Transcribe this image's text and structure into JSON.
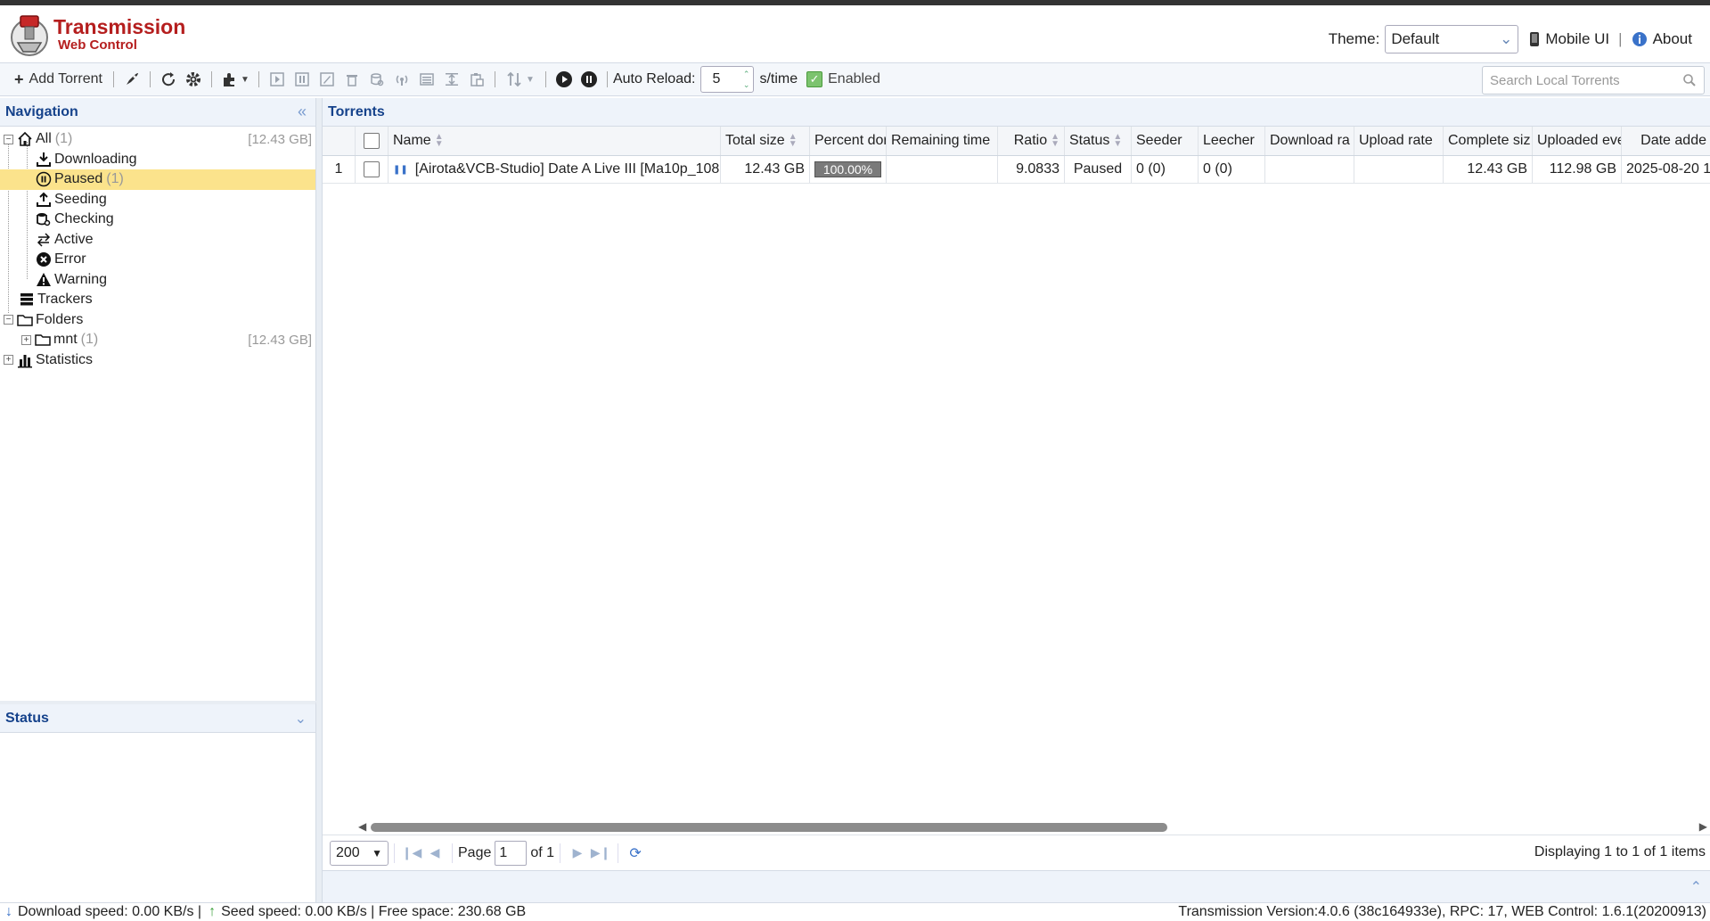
{
  "header": {
    "brand_title": "Transmission",
    "brand_subtitle": "Web Control",
    "theme_label": "Theme:",
    "theme_value": "Default",
    "mobile_ui": "Mobile UI",
    "about": "About"
  },
  "toolbar": {
    "add_torrent": "Add Torrent",
    "auto_reload_label": "Auto Reload:",
    "auto_reload_value": "5",
    "auto_reload_unit": "s/time",
    "enabled_label": "Enabled",
    "search_placeholder": "Search Local Torrents"
  },
  "navigation": {
    "title": "Navigation",
    "all_label": "All",
    "all_count": "(1)",
    "all_size": "[12.43 GB]",
    "downloading": "Downloading",
    "paused": "Paused",
    "paused_count": "(1)",
    "seeding": "Seeding",
    "checking": "Checking",
    "active": "Active",
    "error": "Error",
    "warning": "Warning",
    "trackers": "Trackers",
    "folders": "Folders",
    "mnt_label": "mnt",
    "mnt_count": "(1)",
    "mnt_size": "[12.43 GB]",
    "statistics": "Statistics"
  },
  "status_panel": {
    "title": "Status"
  },
  "torrents": {
    "title": "Torrents",
    "columns": [
      "Name",
      "Total size",
      "Percent dor",
      "Remaining time",
      "Ratio",
      "Status",
      "Seeder",
      "Leecher",
      "Download ra",
      "Upload rate",
      "Complete siz",
      "Uploaded eve",
      "Date adde"
    ],
    "row": {
      "index": "1",
      "name": "[Airota&VCB-Studio] Date A Live III [Ma10p_108",
      "total_size": "12.43 GB",
      "percent_done": "100.00%",
      "percent_value": 1.0,
      "remaining_time": "",
      "ratio": "9.0833",
      "status": "Paused",
      "seeder": "0 (0)",
      "leecher": "0 (0)",
      "download_rate": "",
      "upload_rate": "",
      "complete_size": "12.43 GB",
      "uploaded_ever": "112.98 GB",
      "date_added": "2025-08-20 1"
    }
  },
  "pager": {
    "page_size": "200",
    "page_label": "Page",
    "page_value": "1",
    "of_label": "of 1",
    "display_text": "Displaying 1 to 1 of 1 items"
  },
  "statusbar": {
    "download_speed": "Download speed: 0.00 KB/s |",
    "seed_speed": "Seed speed: 0.00 KB/s | Free space: 230.68 GB",
    "version": "Transmission Version:4.0.6 (38c164933e), RPC: 17, WEB Control: 1.6.1(20200913)"
  },
  "colors": {
    "brand_red": "#b51e1e",
    "panel_title_blue": "#15428b",
    "selected_row": "#fbe38c",
    "progress_gray": "#7a7a7a"
  }
}
